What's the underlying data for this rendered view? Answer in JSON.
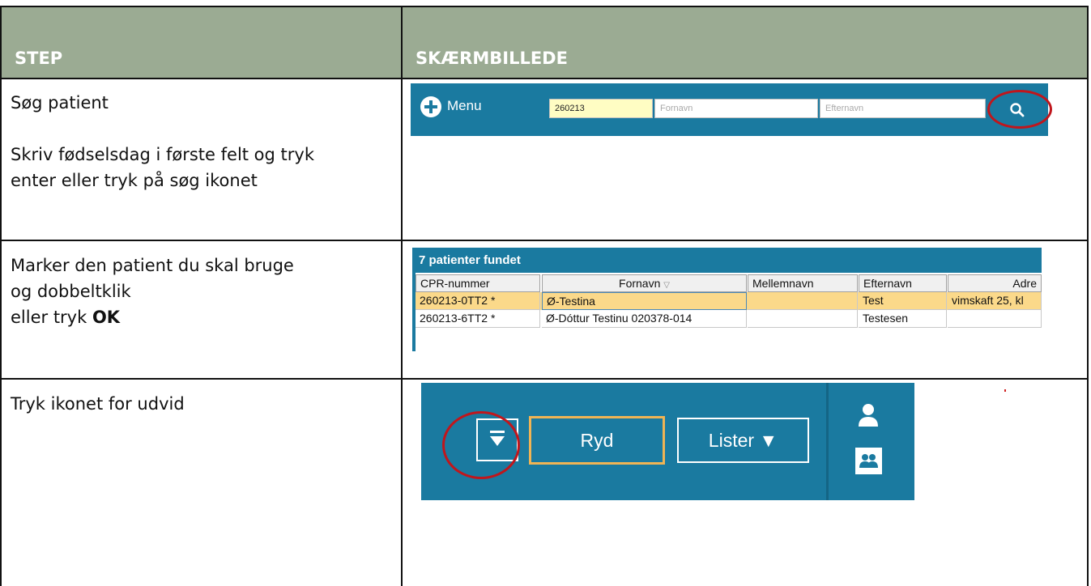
{
  "header": {
    "step_label": "STEP",
    "screen_label": "SKÆRMBILLEDE"
  },
  "rows": [
    {
      "step_lines": [
        "Søg patient",
        "",
        "Skriv fødselsdag i første felt og tryk",
        "enter eller tryk på søg ikonet"
      ]
    },
    {
      "step_lines": [
        "Marker den patient du skal bruge",
        "og dobbeltklik"
      ],
      "step_last_prefix": "eller tryk ",
      "step_last_bold": "OK"
    },
    {
      "step_lines": [
        "Tryk ikonet for udvid"
      ]
    }
  ],
  "search_bar": {
    "menu_label": "Menu",
    "cpr_value": "260213",
    "fornavn_placeholder": "Fornavn",
    "efternavn_placeholder": "Efternavn",
    "icon": "search-icon"
  },
  "patient_list": {
    "title": "7 patienter fundet",
    "columns": [
      "CPR-nummer",
      "Fornavn",
      "Mellemnavn",
      "Efternavn",
      "Adre"
    ],
    "sort_column": "Fornavn",
    "rows": [
      {
        "cpr": "260213-0TT2 *",
        "fornavn": "Ø-Testina",
        "mellemnavn": "",
        "efternavn": "Test",
        "adresse": "vimskaft 25, kl",
        "selected": true
      },
      {
        "cpr": "260213-6TT2 *",
        "fornavn": "Ø-Dóttur Testinu 020378-014",
        "mellemnavn": "",
        "efternavn": "Testesen",
        "adresse": "",
        "selected": false
      }
    ]
  },
  "toolbar": {
    "expand_icon": "expand-icon",
    "ryd_label": "Ryd",
    "lister_label": "Lister ▼",
    "user_icon": "user-icon",
    "users_icon": "users-icon"
  },
  "colors": {
    "header_bg": "#9bab93",
    "app_blue": "#1a7aa0",
    "highlight_circle": "#c0161c",
    "selected_row": "#fbd98a",
    "ryd_border": "#f0b454"
  }
}
